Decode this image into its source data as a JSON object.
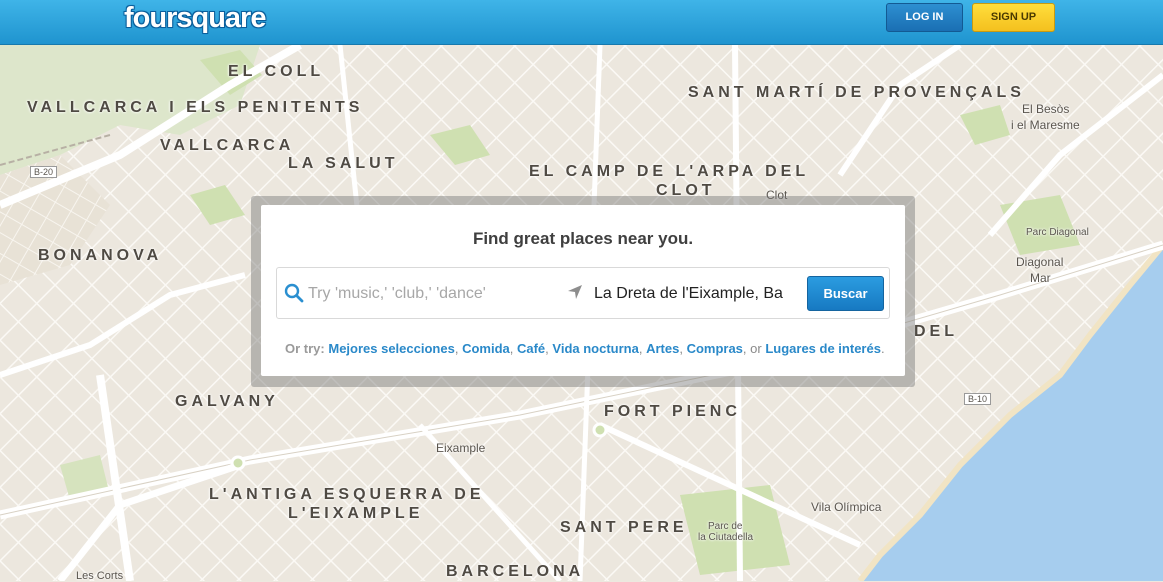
{
  "header": {
    "logo": "foursquare",
    "login_label": "LOG IN",
    "signup_label": "SIGN UP"
  },
  "search": {
    "heading": "Find great places near you.",
    "query_placeholder": "Try 'music,' 'club,' 'dance'",
    "near_value": "La Dreta de l'Eixample, Ba",
    "button_label": "Buscar",
    "suggest_prefix": "Or try:",
    "suggestions": [
      "Mejores selecciones",
      "Comida",
      "Café",
      "Vida nocturna",
      "Artes",
      "Compras"
    ],
    "or_word": "or",
    "last_suggestion": "Lugares de interés"
  },
  "map": {
    "districts": [
      "EL COLL",
      "VALLCARCA I ELS PENITENTS",
      "VALLCARCA",
      "LA SALUT",
      "SANT MARTÍ DE PROVENÇALS",
      "EL CAMP DE L'ARPA DEL",
      "CLOT",
      "BONANOVA",
      "GALVANY",
      "FORT PIENC",
      "L'ANTIGA ESQUERRA DE",
      "L'EIXAMPLE",
      "SANT PERE",
      "BARCELONA",
      "DEL"
    ],
    "places": [
      "El Besòs",
      "i el Maresme",
      "Clot",
      "Diagonal",
      "Mar",
      "Parc Diagonal",
      "Eixample",
      "Vila Olímpica",
      "Parc de",
      "la Ciutadella",
      "Les Corts"
    ],
    "road_badges": [
      "B-20",
      "B-10"
    ]
  },
  "colors": {
    "header": "#2ba3dc",
    "sea": "#a6cdee",
    "park": "#cfe0b1",
    "accent_link": "#2a89c9",
    "signup": "#f7c928"
  }
}
